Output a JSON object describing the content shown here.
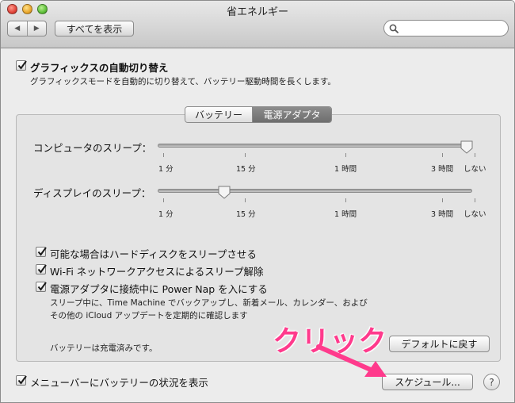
{
  "window": {
    "title": "省エネルギー"
  },
  "toolbar": {
    "show_all": "すべてを表示",
    "back": "◀",
    "forward": "▶"
  },
  "graphics_switching": {
    "label": "グラフィックスの自動切り替え",
    "checked": true,
    "description": "グラフィックスモードを自動的に切り替えて、バッテリー駆動時間を長くします。"
  },
  "tabs": [
    {
      "label": "バッテリー",
      "selected": false
    },
    {
      "label": "電源アダプタ",
      "selected": true
    }
  ],
  "sleep": {
    "computer": {
      "label": "コンピュータのスリープ：",
      "value": "しない"
    },
    "display": {
      "label": "ディスプレイのスリープ：",
      "value": "10 分"
    },
    "tick_labels": [
      "1 分",
      "15 分",
      "1 時間",
      "3 時間",
      "しない"
    ]
  },
  "options": [
    {
      "label": "可能な場合はハードディスクをスリープさせる",
      "checked": true
    },
    {
      "label": "Wi-Fi ネットワークアクセスによるスリープ解除",
      "checked": true
    },
    {
      "label": "電源アダプタに接続中に Power Nap を入にする",
      "checked": true
    }
  ],
  "power_nap_description": [
    "スリープ中に、Time Machine でバックアップし、新着メール、カレンダー、および",
    "その他の iCloud アップデートを定期的に確認します"
  ],
  "battery_status": "バッテリーは充電済みです。",
  "buttons": {
    "restore_defaults": "デフォルトに戻す",
    "schedule": "スケジュール...",
    "help": "?"
  },
  "menubar_option": {
    "label": "メニューバーにバッテリーの状況を表示",
    "checked": true
  },
  "annotation": {
    "text": "クリック",
    "color": "#ff3a8c"
  }
}
